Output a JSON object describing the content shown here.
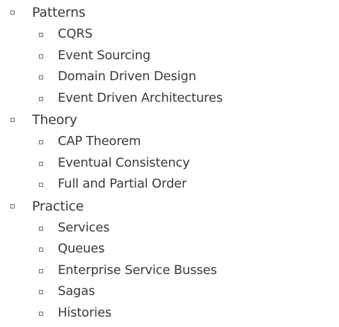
{
  "outline": {
    "sections": [
      {
        "title": "Patterns",
        "items": [
          "CQRS",
          "Event Sourcing",
          "Domain Driven Design",
          "Event Driven Architectures"
        ]
      },
      {
        "title": "Theory",
        "items": [
          "CAP Theorem",
          "Eventual Consistency",
          "Full and Partial Order"
        ]
      },
      {
        "title": "Practice",
        "items": [
          "Services",
          "Queues",
          "Enterprise Service Busses",
          "Sagas",
          "Histories"
        ]
      }
    ]
  }
}
